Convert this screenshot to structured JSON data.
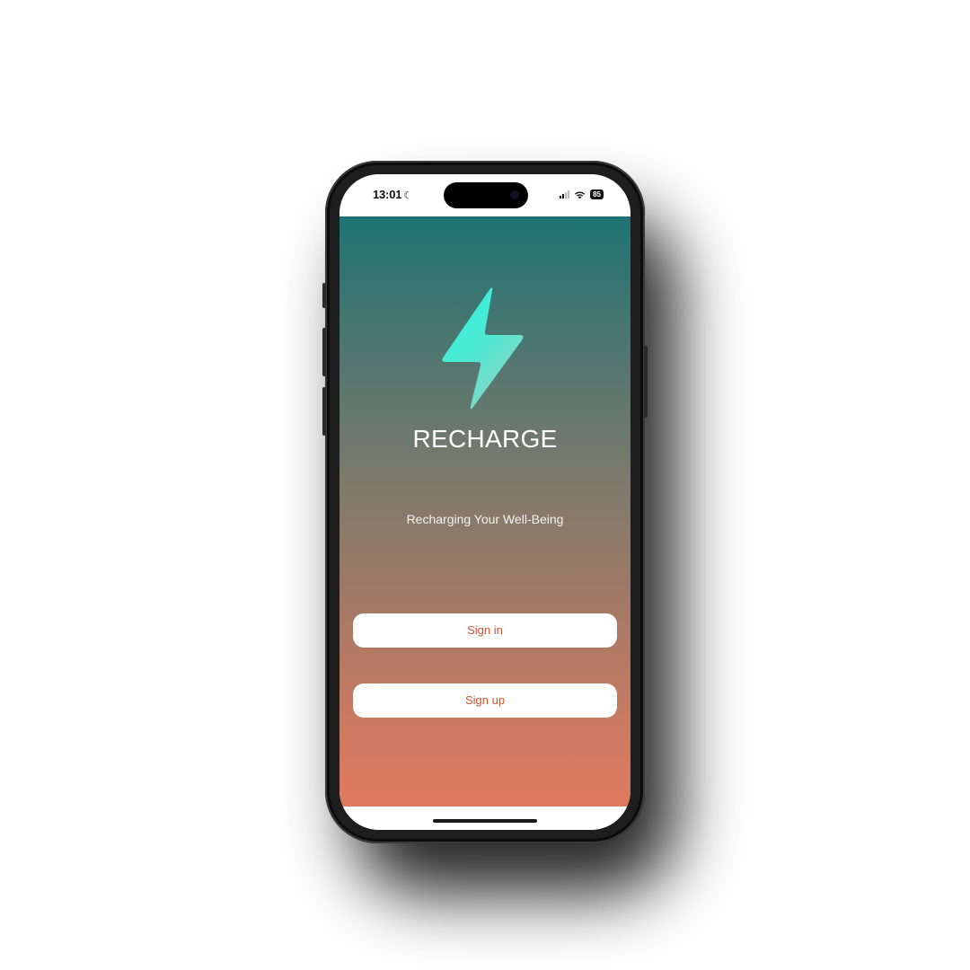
{
  "status_bar": {
    "time": "13:01",
    "battery": "85"
  },
  "app": {
    "name": "RECHARGE",
    "tagline": "Recharging Your Well-Being",
    "logo_icon": "lightning-bolt-icon"
  },
  "actions": {
    "sign_in_label": "Sign in",
    "sign_up_label": "Sign up"
  },
  "colors": {
    "gradient_top": "#1e7472",
    "gradient_bottom": "#e07a5f",
    "bolt_primary": "#2ef0de",
    "button_text": "#d3512f",
    "button_bg": "#ffffff"
  }
}
